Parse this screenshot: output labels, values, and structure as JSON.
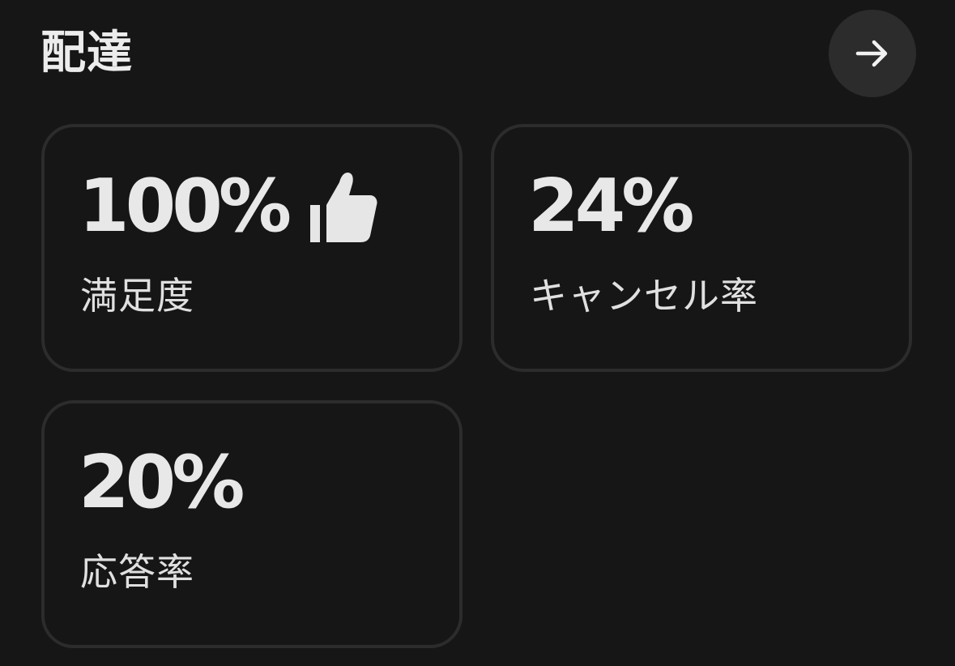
{
  "header": {
    "title": "配達",
    "next_icon": "arrow-right-icon"
  },
  "metrics": [
    {
      "value": "100%",
      "label": "満足度",
      "icon": "thumbs-up-icon"
    },
    {
      "value": "24%",
      "label": "キャンセル率"
    },
    {
      "value": "20%",
      "label": "応答率"
    }
  ],
  "colors": {
    "background": "#161616",
    "card_border": "#2c2c2c",
    "button_bg": "#2c2c2c",
    "text": "#e6e6e6"
  }
}
